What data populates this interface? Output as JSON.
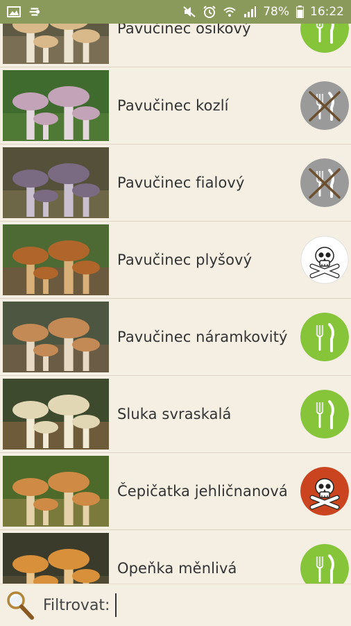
{
  "status_bar": {
    "battery": "78%",
    "time": "16:22",
    "left_icons": [
      "image-icon",
      "speed-icon"
    ],
    "right_icons": [
      "mute-icon",
      "alarm-icon",
      "wifi-icon",
      "signal-icon",
      "battery-icon"
    ]
  },
  "colors": {
    "status_bar": "#8a9a5b",
    "background": "#f5efe3",
    "edible": "#86c43a",
    "inedible": "#9a9a9a",
    "poisonous": "#ffffff",
    "deadly": "#c9441f"
  },
  "mushrooms": [
    {
      "name": "Pavučinec osikový",
      "edibility": "edible",
      "icon": "edible-icon"
    },
    {
      "name": "Pavučinec kozlí",
      "edibility": "inedible",
      "icon": "inedible-icon"
    },
    {
      "name": "Pavučinec fialový",
      "edibility": "inedible",
      "icon": "inedible-icon"
    },
    {
      "name": "Pavučinec plyšový",
      "edibility": "poisonous",
      "icon": "skull-icon"
    },
    {
      "name": "Pavučinec náramkovitý",
      "edibility": "edible",
      "icon": "edible-icon"
    },
    {
      "name": "Sluka svraskalá",
      "edibility": "edible",
      "icon": "edible-icon"
    },
    {
      "name": "Čepičatka jehličnanová",
      "edibility": "deadly",
      "icon": "deadly-skull-icon"
    },
    {
      "name": "Opeňka měnlivá",
      "edibility": "edible",
      "icon": "edible-icon"
    }
  ],
  "filter": {
    "label": "Filtrovat:",
    "value": "",
    "icon": "magnifier-icon"
  }
}
